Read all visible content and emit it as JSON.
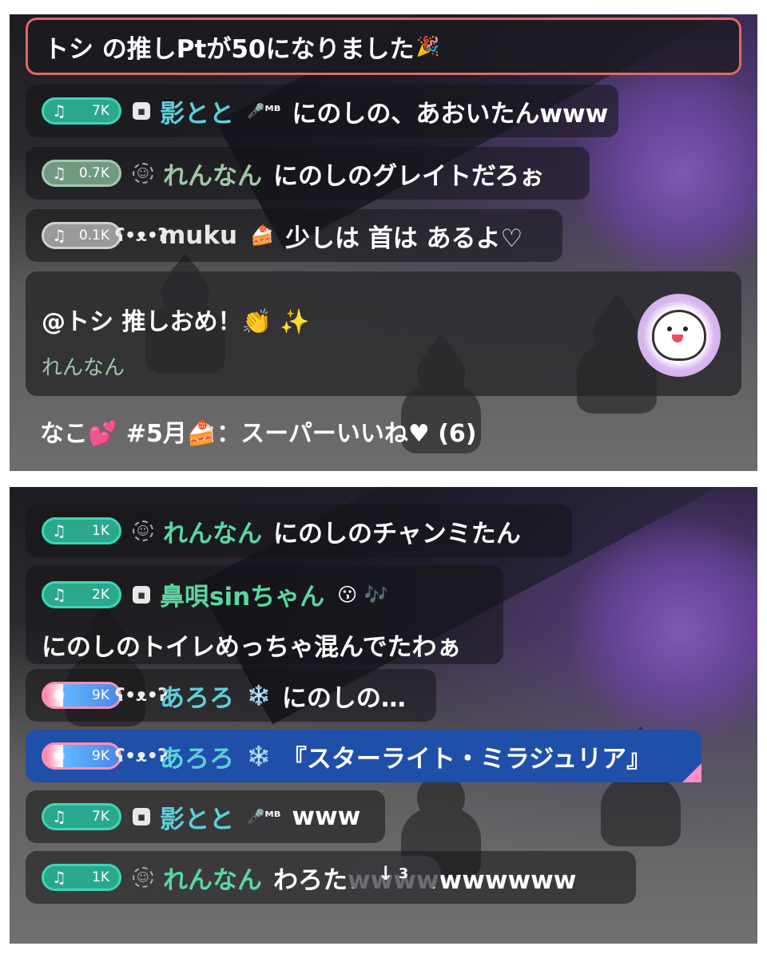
{
  "panel1": {
    "announcement": {
      "text": "トシ の推しPtが50になりました",
      "emoji": "🎉"
    },
    "comments": [
      {
        "level": "7K",
        "badge_style": "teal",
        "rank_icon": "chat-badge-icon",
        "username": "影とと",
        "user_emoji": "🎤ᴹᴮ",
        "message": "にのしの、あおいたんwww"
      },
      {
        "level": "0.7K",
        "badge_style": "sage",
        "rank_icon": "dashed-circle-icon",
        "username": "れんなん",
        "user_emoji": "",
        "message": "にのしのグレイトだろぉ"
      },
      {
        "level": "0.1K",
        "badge_style": "gray",
        "rank_icon": "bear-icon",
        "username": "muku",
        "user_emoji": "🍰",
        "message": "少しは 首は あるよ♡"
      }
    ],
    "mention": {
      "text": "@トシ 推しおめ！👏 ✨",
      "user": "れんなん",
      "sticker": "seal-sticker-icon"
    },
    "super_like": {
      "user": "なこ💕",
      "text": " #5月🍰：スーパーいいね♥ (6)"
    }
  },
  "panel2": {
    "comments": [
      {
        "level": "1K",
        "badge_style": "green",
        "rank_icon": "dashed-circle-icon",
        "username": "れんなん",
        "user_emoji": "",
        "message": "にのしのチャンミたん"
      },
      {
        "level": "2K",
        "badge_style": "green",
        "rank_icon": "chat-badge-icon",
        "username": "鼻唄sinちゃん",
        "user_emoji": "😗 🎶",
        "message": "にのしのトイレめっちゃ混んでたわぁ"
      },
      {
        "level": "9K",
        "badge_style": "rainbow",
        "rank_icon": "bear-icon",
        "username": "あろろ",
        "user_emoji": "❄️",
        "message": "にのしの…"
      },
      {
        "level": "9K",
        "badge_style": "rainbow",
        "rank_icon": "bear-icon",
        "username": "あろろ",
        "user_emoji": "❄️",
        "message": "『スターライト・ミラジュリア』"
      },
      {
        "level": "7K",
        "badge_style": "teal",
        "rank_icon": "chat-badge-icon",
        "username": "影とと",
        "user_emoji": "🎤ᴹᴮ",
        "message": "www"
      },
      {
        "level": "1K",
        "badge_style": "green",
        "rank_icon": "dashed-circle-icon",
        "username": "れんなん",
        "user_emoji": "",
        "message": "わろたwwwwwwwwww"
      }
    ],
    "new_comments_pill": {
      "arrow": "↓",
      "count": "3"
    }
  },
  "icons": {
    "note": "♫"
  },
  "colors": {
    "badge_teal": "#3ed6b6",
    "username_teal": "#5ed0d8",
    "username_green": "#5cd6a0",
    "announce_border": "#e06868",
    "highlight_blue": "#1f4fa8"
  }
}
